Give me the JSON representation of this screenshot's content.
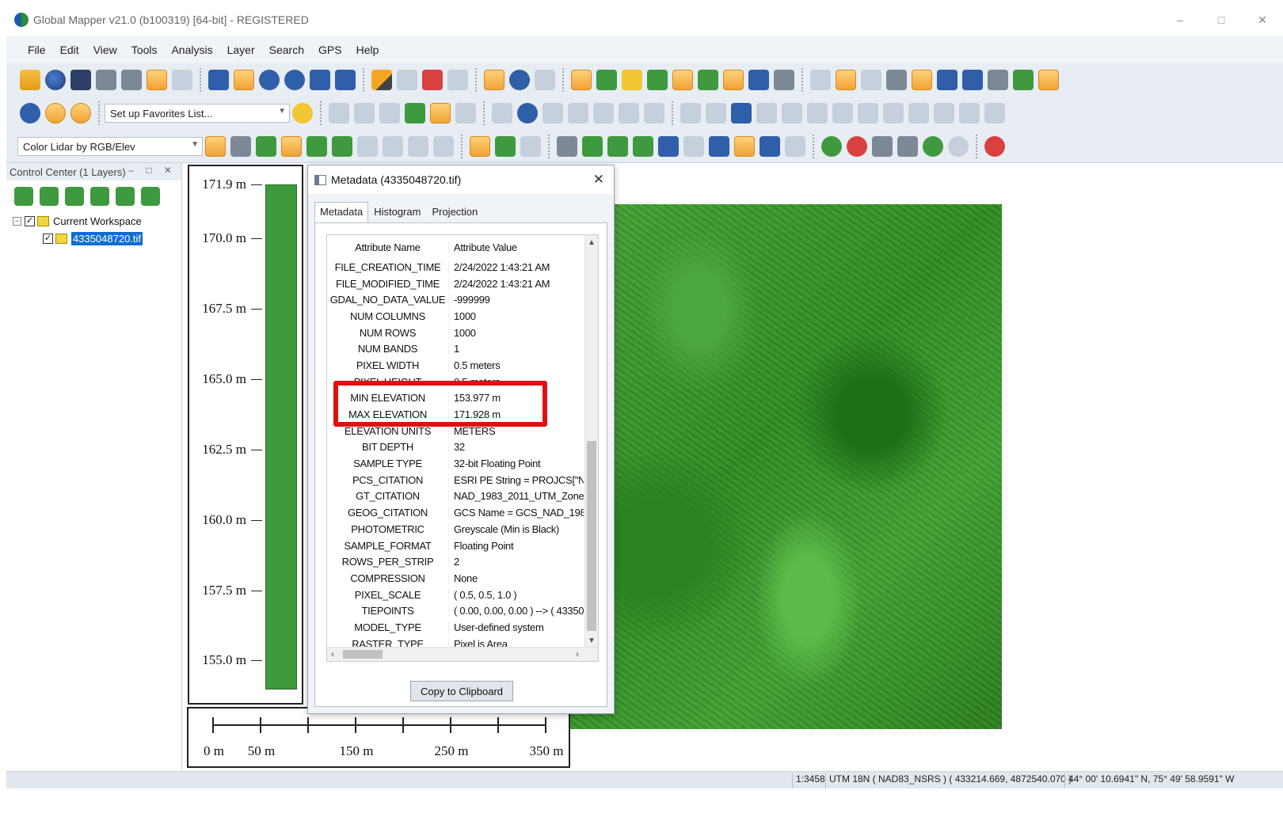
{
  "window": {
    "title": "Global Mapper v21.0 (b100319) [64-bit] - REGISTERED",
    "minimize": "–",
    "maximize": "□",
    "close": "✕"
  },
  "menu": [
    "File",
    "Edit",
    "View",
    "Tools",
    "Analysis",
    "Layer",
    "Search",
    "GPS",
    "Help"
  ],
  "toolbar": {
    "favorites_combo": "Set up Favorites List...",
    "shader_combo": "Color Lidar by RGB/Elev"
  },
  "control_center": {
    "title": "Control Center (1 Layers)",
    "workspace_label": "Current Workspace",
    "layer_label": "4335048720.tif",
    "expander": "−",
    "check": "✓"
  },
  "elevation_legend": {
    "labels": [
      "171.9 m",
      "170.0 m",
      "167.5 m",
      "165.0 m",
      "162.5 m",
      "160.0 m",
      "157.5 m",
      "155.0 m"
    ]
  },
  "scale_bar": {
    "labels": [
      "0 m",
      "50 m",
      "150 m",
      "250 m",
      "350 m"
    ]
  },
  "dialog": {
    "title": "Metadata (4335048720.tif)",
    "close": "✕",
    "tabs": [
      "Metadata",
      "Histogram",
      "Projection"
    ],
    "active_tab": "Metadata",
    "columns": [
      "Attribute Name",
      "Attribute Value"
    ],
    "rows": [
      [
        "FILE_CREATION_TIME",
        "2/24/2022 1:43:21 AM"
      ],
      [
        "FILE_MODIFIED_TIME",
        "2/24/2022 1:43:21 AM"
      ],
      [
        "GDAL_NO_DATA_VALUE",
        "-999999"
      ],
      [
        "NUM COLUMNS",
        "1000"
      ],
      [
        "NUM ROWS",
        "1000"
      ],
      [
        "NUM BANDS",
        "1"
      ],
      [
        "PIXEL WIDTH",
        "0.5 meters"
      ],
      [
        "PIXEL HEIGHT",
        "0.5 meters"
      ],
      [
        "MIN ELEVATION",
        "153.977 m"
      ],
      [
        "MAX ELEVATION",
        "171.928 m"
      ],
      [
        "ELEVATION UNITS",
        "METERS"
      ],
      [
        "BIT DEPTH",
        "32"
      ],
      [
        "SAMPLE TYPE",
        "32-bit Floating Point"
      ],
      [
        "PCS_CITATION",
        "ESRI PE String = PROJCS[\"N/"
      ],
      [
        "GT_CITATION",
        "NAD_1983_2011_UTM_Zone_"
      ],
      [
        "GEOG_CITATION",
        "GCS Name = GCS_NAD_1983"
      ],
      [
        "PHOTOMETRIC",
        "Greyscale (Min is Black)"
      ],
      [
        "SAMPLE_FORMAT",
        "Floating Point"
      ],
      [
        "ROWS_PER_STRIP",
        "2"
      ],
      [
        "COMPRESSION",
        "None"
      ],
      [
        "PIXEL_SCALE",
        "( 0.5, 0.5, 1.0 )"
      ],
      [
        "TIEPOINTS",
        "( 0.00, 0.00, 0.00 ) --> ( 43350"
      ],
      [
        "MODEL_TYPE",
        "User-defined system"
      ],
      [
        "RASTER_TYPE",
        "Pixel is Area"
      ]
    ],
    "copy_button": "Copy to Clipboard"
  },
  "status_bar": {
    "scale": "1:3458",
    "projection": "UTM 18N ( NAD83_NSRS ) ( 433214.669, 4872540.070 )",
    "latlon": "44° 00' 10.6941\" N, 75° 49' 58.9591\" W"
  },
  "colors": {
    "highlight": "#e01010",
    "elevation_bar": "#3d9a3a",
    "selection": "#0f6fcf"
  }
}
